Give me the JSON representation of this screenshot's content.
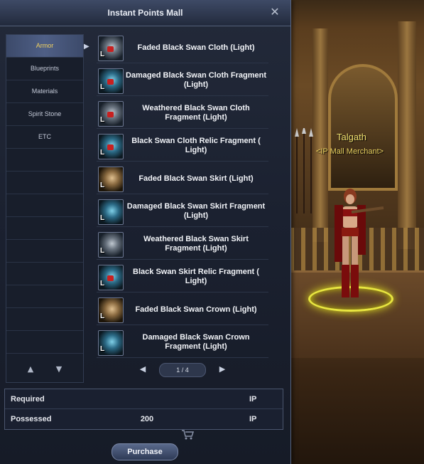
{
  "window": {
    "title": "Instant Points Mall",
    "close_symbol": "✕"
  },
  "categories": [
    {
      "label": "Armor",
      "active": true
    },
    {
      "label": "Blueprints",
      "active": false
    },
    {
      "label": "Materials",
      "active": false
    },
    {
      "label": "Spirit Stone",
      "active": false
    },
    {
      "label": "ETC",
      "active": false
    }
  ],
  "items": [
    {
      "name": "Faded Black Swan Cloth (Light)",
      "tier": "L",
      "icon": "cloth-icon"
    },
    {
      "name": "Damaged Black Swan Cloth Fragment (Light)",
      "tier": "L",
      "icon": "cloth-fragment-icon"
    },
    {
      "name": "Weathered Black Swan Cloth Fragment (Light)",
      "tier": "L",
      "icon": "cloth-fragment-icon"
    },
    {
      "name": "Black Swan Cloth Relic Fragment ( Light)",
      "tier": "L",
      "icon": "cloth-relic-icon"
    },
    {
      "name": "Faded Black Swan Skirt (Light)",
      "tier": "L",
      "icon": "skirt-icon"
    },
    {
      "name": "Damaged Black Swan Skirt Fragment (Light)",
      "tier": "L",
      "icon": "skirt-fragment-icon"
    },
    {
      "name": "Weathered Black Swan Skirt Fragment (Light)",
      "tier": "L",
      "icon": "skirt-fragment-icon"
    },
    {
      "name": "Black Swan Skirt Relic Fragment ( Light)",
      "tier": "L",
      "icon": "skirt-relic-icon"
    },
    {
      "name": "Faded Black Swan Crown (Light)",
      "tier": "L",
      "icon": "crown-icon"
    },
    {
      "name": "Damaged Black Swan Crown Fragment (Light)",
      "tier": "L",
      "icon": "crown-fragment-icon"
    }
  ],
  "pager": {
    "label": "1 / 4",
    "prev_symbol": "◀",
    "next_symbol": "▶"
  },
  "category_scroll": {
    "up_symbol": "▲",
    "down_symbol": "▼",
    "active_marker": "▶"
  },
  "cost": {
    "required_label": "Required",
    "required_value": "",
    "required_unit": "IP",
    "possessed_label": "Possessed",
    "possessed_value": "200",
    "possessed_unit": "IP"
  },
  "purchase_label": "Purchase",
  "npc": {
    "name": "Talgath",
    "title": "<IP Mall Merchant>"
  },
  "colors": {
    "window_bg": "#1b2130",
    "active_category_text": "#f0d060",
    "npc_name": "#f0e070",
    "selection_ring": "#e8e640"
  }
}
